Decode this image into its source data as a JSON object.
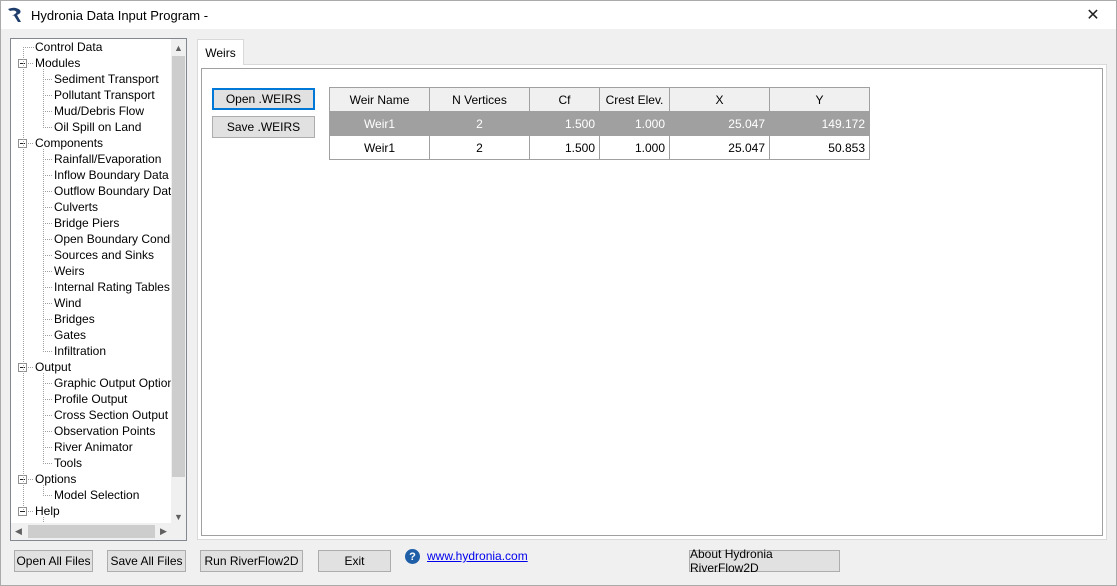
{
  "window": {
    "title": "Hydronia Data Input Program -",
    "close_glyph": "✕"
  },
  "tree": {
    "items": [
      {
        "label": "Control Data",
        "level": 0,
        "expandable": false
      },
      {
        "label": "Modules",
        "level": 0,
        "expandable": true
      },
      {
        "label": "Sediment Transport",
        "level": 1
      },
      {
        "label": "Pollutant Transport",
        "level": 1
      },
      {
        "label": "Mud/Debris Flow",
        "level": 1
      },
      {
        "label": "Oil Spill on Land",
        "level": 1
      },
      {
        "label": "Components",
        "level": 0,
        "expandable": true
      },
      {
        "label": "Rainfall/Evaporation",
        "level": 1
      },
      {
        "label": "Inflow Boundary Data",
        "level": 1
      },
      {
        "label": "Outflow Boundary Data",
        "level": 1
      },
      {
        "label": "Culverts",
        "level": 1
      },
      {
        "label": "Bridge Piers",
        "level": 1
      },
      {
        "label": "Open Boundary Conditions",
        "level": 1
      },
      {
        "label": "Sources and Sinks",
        "level": 1
      },
      {
        "label": "Weirs",
        "level": 1
      },
      {
        "label": "Internal Rating Tables",
        "level": 1
      },
      {
        "label": "Wind",
        "level": 1
      },
      {
        "label": "Bridges",
        "level": 1
      },
      {
        "label": "Gates",
        "level": 1
      },
      {
        "label": "Infiltration",
        "level": 1
      },
      {
        "label": "Output",
        "level": 0,
        "expandable": true
      },
      {
        "label": "Graphic Output Options",
        "level": 1
      },
      {
        "label": "Profile Output",
        "level": 1
      },
      {
        "label": "Cross Section Output",
        "level": 1
      },
      {
        "label": "Observation Points",
        "level": 1
      },
      {
        "label": "River Animator",
        "level": 1
      },
      {
        "label": "Tools",
        "level": 1
      },
      {
        "label": "Options",
        "level": 0,
        "expandable": true
      },
      {
        "label": "Model Selection",
        "level": 1
      },
      {
        "label": "Help",
        "level": 0,
        "expandable": true
      }
    ],
    "scroll_up": "▲",
    "scroll_down": "▼",
    "scroll_left": "◀",
    "scroll_right": "▶"
  },
  "tab": {
    "label": "Weirs"
  },
  "weirs": {
    "open_label": "Open .WEIRS",
    "save_label": "Save .WEIRS",
    "columns": [
      "Weir Name",
      "N Vertices",
      "Cf",
      "Crest Elev.",
      "X",
      "Y"
    ],
    "rows": [
      {
        "name": "Weir1",
        "n_vertices": "2",
        "cf": "1.500",
        "crest": "1.000",
        "x": "25.047",
        "y": "149.172",
        "selected": true
      },
      {
        "name": "Weir1",
        "n_vertices": "2",
        "cf": "1.500",
        "crest": "1.000",
        "x": "25.047",
        "y": "50.853",
        "selected": false
      }
    ]
  },
  "footer": {
    "open_all": "Open All Files",
    "save_all": "Save All Files",
    "run": "Run RiverFlow2D",
    "exit": "Exit",
    "help_glyph": "?",
    "link": "www.hydronia.com",
    "about": "About Hydronia RiverFlow2D"
  },
  "colors": {
    "selected_row": "#a0a0a0",
    "focus_border": "#0078d7",
    "link": "#0000ee"
  }
}
